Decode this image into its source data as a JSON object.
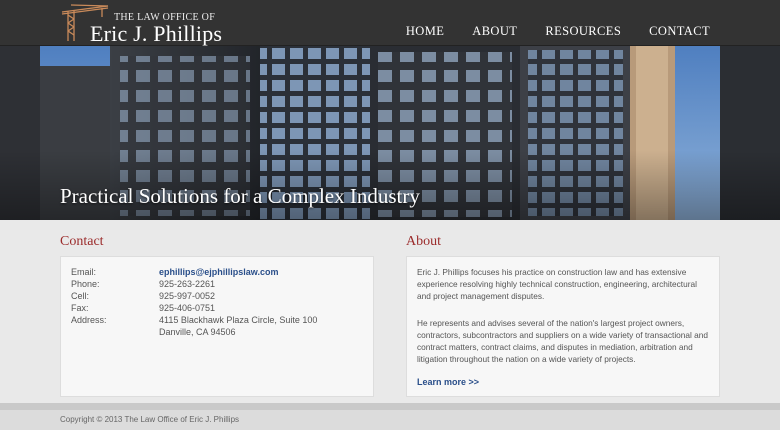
{
  "header": {
    "logo_small": "THE LAW OFFICE OF",
    "logo_big": "Eric J. Phillips",
    "nav": [
      "HOME",
      "ABOUT",
      "RESOURCES",
      "CONTACT"
    ]
  },
  "hero": {
    "tagline": "Practical Solutions for a Complex Industry"
  },
  "contact": {
    "title": "Contact",
    "rows": [
      {
        "label": "Email:",
        "value": "ephillips@ejphillipslaw.com"
      },
      {
        "label": "Phone:",
        "value": "925-263-2261"
      },
      {
        "label": "Cell:",
        "value": "925-997-0052"
      },
      {
        "label": "Fax:",
        "value": "925-406-0751"
      },
      {
        "label": "Address:",
        "value": "4115 Blackhawk Plaza Circle, Suite 100"
      },
      {
        "label": "",
        "value": "Danville, CA 94506"
      }
    ]
  },
  "about": {
    "title": "About",
    "p1": "Eric J. Phillips focuses his practice on construction law and has extensive experience resolving highly technical construction, engineering, architectural and project management disputes.",
    "p2": "He represents and advises several of the nation's largest project owners, contractors, subcontractors and suppliers on a wide variety of transactional and contract matters, contract claims, and disputes in mediation, arbitration and litigation throughout the nation on a wide variety of projects.",
    "learn_more": "Learn more >>"
  },
  "footer": {
    "copyright": "Copyright © 2013 The Law Office of Eric J. Phillips"
  },
  "colors": {
    "header_bg": "#333333",
    "accent_title": "#9b2b2b",
    "link": "#2a4f8a",
    "page_bg": "#e9e9e9"
  }
}
